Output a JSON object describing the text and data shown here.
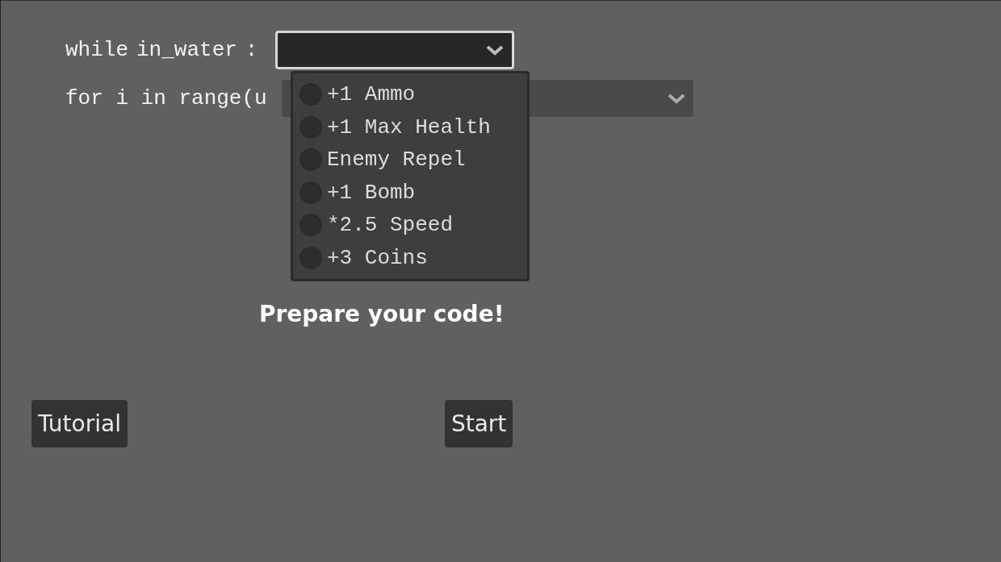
{
  "code_lines": [
    {
      "keyword": "while",
      "argument": "in_water",
      "suffix": ":",
      "select": {
        "open": true
      }
    },
    {
      "keyword": "for i in range(",
      "argument": "u",
      "select": {
        "open": false
      }
    }
  ],
  "dropdown_options": [
    {
      "label": "+1 Ammo",
      "selected": false
    },
    {
      "label": "+1 Max Health",
      "selected": false
    },
    {
      "label": "Enemy Repel",
      "selected": false
    },
    {
      "label": "+1 Bomb",
      "selected": false
    },
    {
      "label": "*2.5 Speed",
      "selected": false
    },
    {
      "label": "+3 Coins",
      "selected": false
    }
  ],
  "message": "Prepare your code!",
  "buttons": [
    {
      "label": "Tutorial"
    },
    {
      "label": "Start"
    }
  ]
}
